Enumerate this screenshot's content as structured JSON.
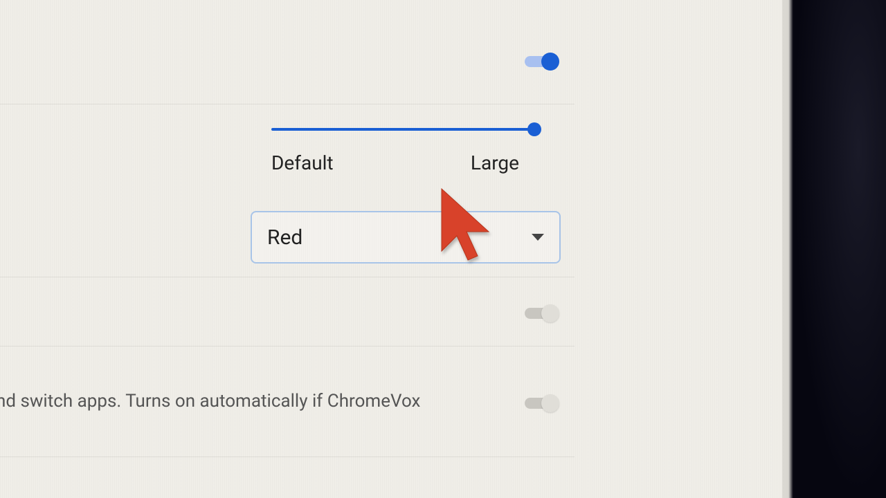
{
  "toggles": {
    "top": {
      "state": "on"
    },
    "mid": {
      "state": "off"
    },
    "bottom": {
      "state": "off"
    }
  },
  "cursor_size_slider": {
    "min_label": "Default",
    "max_label": "Large",
    "value": 100
  },
  "cursor_color_dropdown": {
    "selected": "Red"
  },
  "cursor_preview": {
    "color": "#d8432a"
  },
  "partial_description": "nd switch apps. Turns on automatically if ChromeVox",
  "colors": {
    "accent": "#1a5fd4"
  }
}
